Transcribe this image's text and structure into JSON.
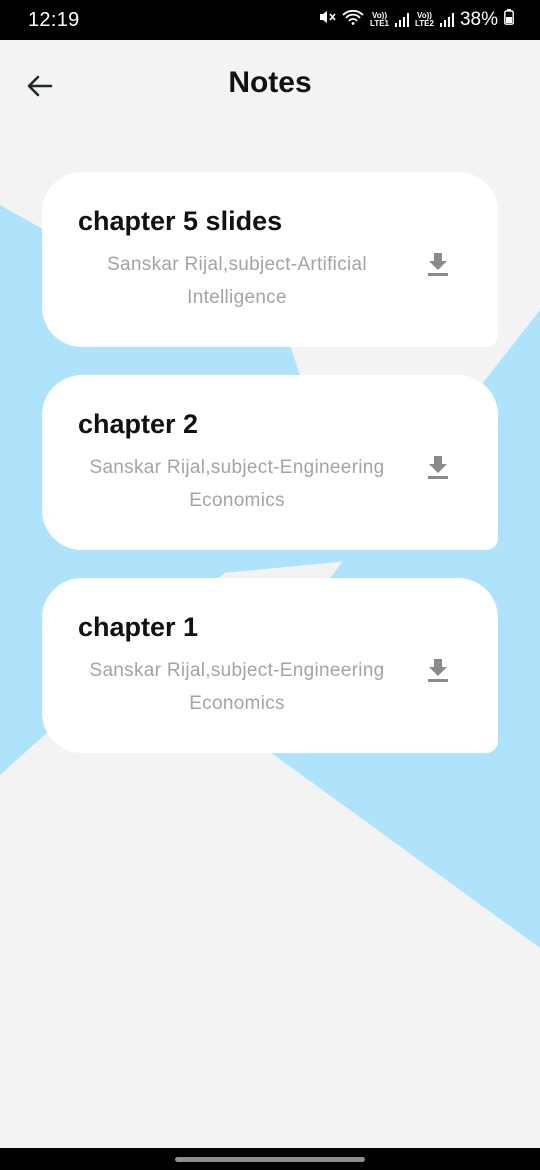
{
  "status_bar": {
    "time": "12:19",
    "sim1_label": "Vo)) LTE1",
    "sim2_label": "Vo)) LTE2",
    "battery": "38%"
  },
  "header": {
    "title": "Notes",
    "back_icon": "arrow-left-icon"
  },
  "notes": [
    {
      "title": "chapter 5 slides",
      "subtitle": "Sanskar Rijal,subject-Artificial Intelligence",
      "action_icon": "download-icon"
    },
    {
      "title": "chapter 2",
      "subtitle": "Sanskar Rijal,subject-Engineering Economics",
      "action_icon": "download-icon"
    },
    {
      "title": "chapter 1",
      "subtitle": "Sanskar Rijal,subject-Engineering Economics",
      "action_icon": "download-icon"
    }
  ],
  "colors": {
    "background": "#f3f3f3",
    "accent_shape": "#aee3fb",
    "card": "#ffffff",
    "subtitle": "#a4a4a4",
    "icon": "#8a8a8a"
  }
}
